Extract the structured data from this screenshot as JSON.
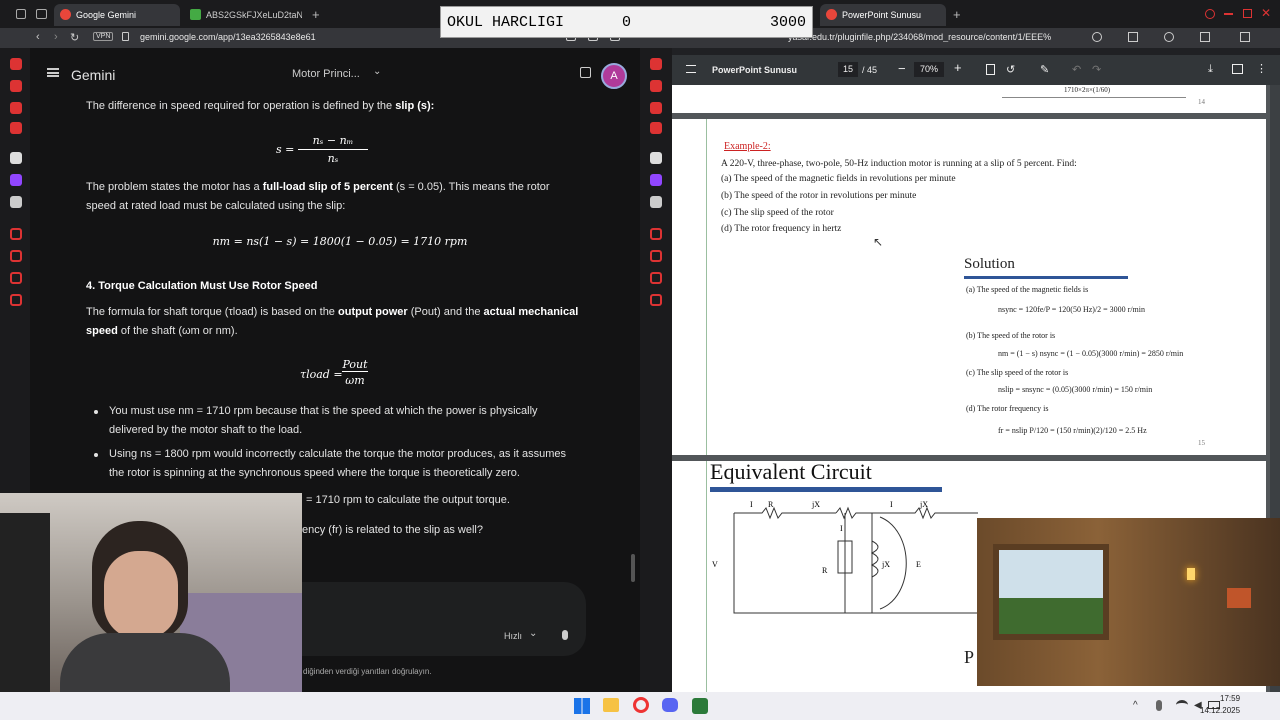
{
  "overlay": {
    "label": "OKUL HARCLIGI",
    "value": "0",
    "target": "3000"
  },
  "left_browser": {
    "tabs": [
      {
        "label": "Google Gemini"
      },
      {
        "label": "ABS2GSkFJXeLuD2taNP"
      }
    ],
    "vpn": "VPN",
    "url": "gemini.google.com/app/13ea3265843e8e61"
  },
  "gemini": {
    "title": "Gemini",
    "model": "Motor Princi...",
    "avatar": "A",
    "p1": "The difference in speed required for operation is defined by the",
    "p1_bold": "slip (s):",
    "eq1": "s = (ns − nm) / ns",
    "p2_a": "The problem states the motor has a",
    "p2_b": "full-load slip of 5 percent",
    "p2_c": "(s = 0.05). This means the rotor",
    "p2_d": "speed at rated load must be calculated using the slip:",
    "eq2": "nm = ns(1 − s) = 1800(1 − 0.05) = 1710 rpm",
    "h4": "4. Torque Calculation Must Use Rotor Speed",
    "p3_a": "The formula for shaft torque (τload) is based on the",
    "p3_b": "output power",
    "p3_c": "(Pout) and the",
    "p3_d": "actual mechanical",
    "p3_e": "speed",
    "p3_f": "of the shaft (ωm or nm).",
    "eq3_num": "Pout",
    "eq3_den": "ωm",
    "eq3_lhs": "τload =",
    "b1_a": "You must use nm = 1710 rpm because that is the speed at which the power is physically",
    "b1_b": "delivered by the motor shaft to the load.",
    "b2_a": "Using ns = 1800 rpm would incorrectly calculate the torque the motor produces, as it assumes",
    "b2_b": "the rotor is spinning at the synchronous speed where the torque is theoretically zero.",
    "b3": "= 1710 rpm to calculate the output torque.",
    "b4": "ency (fr) is related to the slip as well?",
    "speed": "Hızlı",
    "disclaimer": "diğinden verdiği yanıtları doğrulayın."
  },
  "right_browser": {
    "tab": "PowerPoint Sunusu",
    "url": "yasar.edu.tr/pluginfile.php/234068/mod_resource/content/1/EEE%",
    "pdf_title": "PowerPoint Sunusu",
    "page_current": "15",
    "page_total": "/ 45",
    "zoom": "70%",
    "prev_caption": "1710×2π×(1/60)",
    "prev_page": "14"
  },
  "slide": {
    "example": "Example-2:",
    "problem": "A 220-V, three-phase, two-pole, 50-Hz induction motor is running at a slip of 5 percent. Find:",
    "qa": "(a) The speed of the magnetic fields in revolutions per minute",
    "qb": "(b) The speed of the rotor in revolutions per minute",
    "qc": "(c) The slip speed of the rotor",
    "qd": "(d) The rotor frequency in hertz",
    "solution": "Solution",
    "sa": "(a)   The speed of the magnetic fields is",
    "sa_eq": "nsync = 120fe/P = 120(50 Hz)/2 = 3000 r/min",
    "sb": "(b)   The speed of the rotor is",
    "sb_eq": "nm = (1 − s) nsync = (1 − 0.05)(3000 r/min) = 2850 r/min",
    "sc": "(c)   The slip speed of the rotor is",
    "sc_eq": "nslip = snsync = (0.05)(3000 r/min) = 150 r/min",
    "sd": "(d)   The rotor frequency is",
    "sd_eq": "fr = nslip P/120 = (150 r/min)(2)/120 = 2.5 Hz",
    "page": "15",
    "next_title": "Equivalent Circuit",
    "next_partial": "P"
  },
  "taskbar": {
    "time": "17:59",
    "date": "14.12.2025"
  }
}
